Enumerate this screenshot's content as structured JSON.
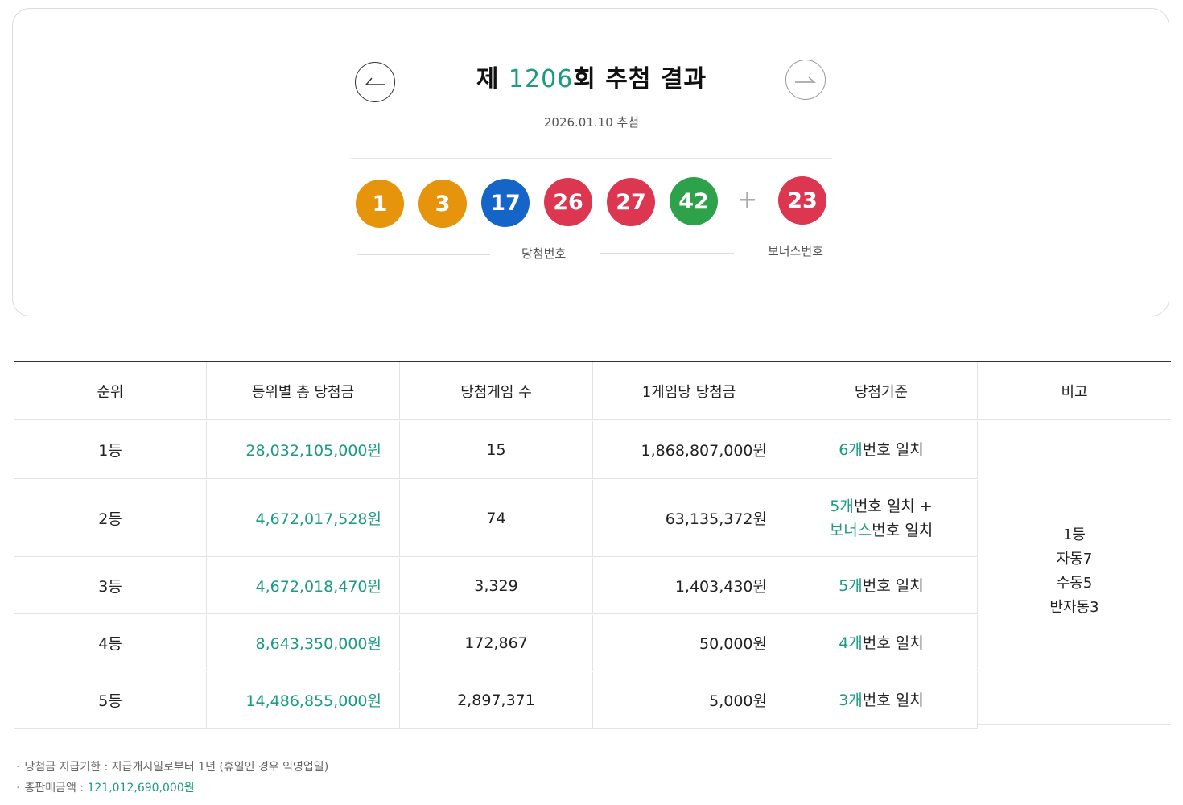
{
  "header": {
    "title_prefix": "제 ",
    "round": "1206",
    "title_suffix": "회 추첨 결과",
    "date": "2026.01.10 추첨"
  },
  "numbers": {
    "winning": [
      {
        "value": "1",
        "color": "#e5940b"
      },
      {
        "value": "3",
        "color": "#e5940b"
      },
      {
        "value": "17",
        "color": "#1565c8"
      },
      {
        "value": "26",
        "color": "#dc3650"
      },
      {
        "value": "27",
        "color": "#dc3650"
      },
      {
        "value": "42",
        "color": "#2ea24a"
      }
    ],
    "plus": "+",
    "bonus": {
      "value": "23",
      "color": "#dc3650"
    },
    "winning_label": "당첨번호",
    "bonus_label": "보너스번호"
  },
  "table": {
    "headers": [
      "순위",
      "등위별 총 당첨금",
      "당첨게임 수",
      "1게임당 당첨금",
      "당첨기준",
      "비고"
    ],
    "rows": [
      {
        "rank": "1등",
        "total": "28,032,105,000원",
        "games": "15",
        "per_game": "1,868,807,000원",
        "crit_a_num": "6개",
        "crit_a_text": "번호 일치",
        "crit_b_num": "",
        "crit_b_text": ""
      },
      {
        "rank": "2등",
        "total": "4,672,017,528원",
        "games": "74",
        "per_game": "63,135,372원",
        "crit_a_num": "5개",
        "crit_a_text": "번호 일치 +",
        "crit_b_num": "보너스",
        "crit_b_text": "번호 일치"
      },
      {
        "rank": "3등",
        "total": "4,672,018,470원",
        "games": "3,329",
        "per_game": "1,403,430원",
        "crit_a_num": "5개",
        "crit_a_text": "번호 일치",
        "crit_b_num": "",
        "crit_b_text": ""
      },
      {
        "rank": "4등",
        "total": "8,643,350,000원",
        "games": "172,867",
        "per_game": "50,000원",
        "crit_a_num": "4개",
        "crit_a_text": "번호 일치",
        "crit_b_num": "",
        "crit_b_text": ""
      },
      {
        "rank": "5등",
        "total": "14,486,855,000원",
        "games": "2,897,371",
        "per_game": "5,000원",
        "crit_a_num": "3개",
        "crit_a_text": "번호 일치",
        "crit_b_num": "",
        "crit_b_text": ""
      }
    ],
    "note_lines": [
      "1등",
      "자동7",
      "수동5",
      "반자동3"
    ]
  },
  "footnotes": {
    "bullet": "·",
    "deadline": "당첨금 지급기한 : 지급개시일로부터 1년 (휴일인 경우 익영업일)",
    "sales_label": "총판매금액 : ",
    "sales_value": "121,012,690,000원"
  },
  "icons": {
    "prev": "arrow-left-icon",
    "next": "arrow-right-icon"
  }
}
